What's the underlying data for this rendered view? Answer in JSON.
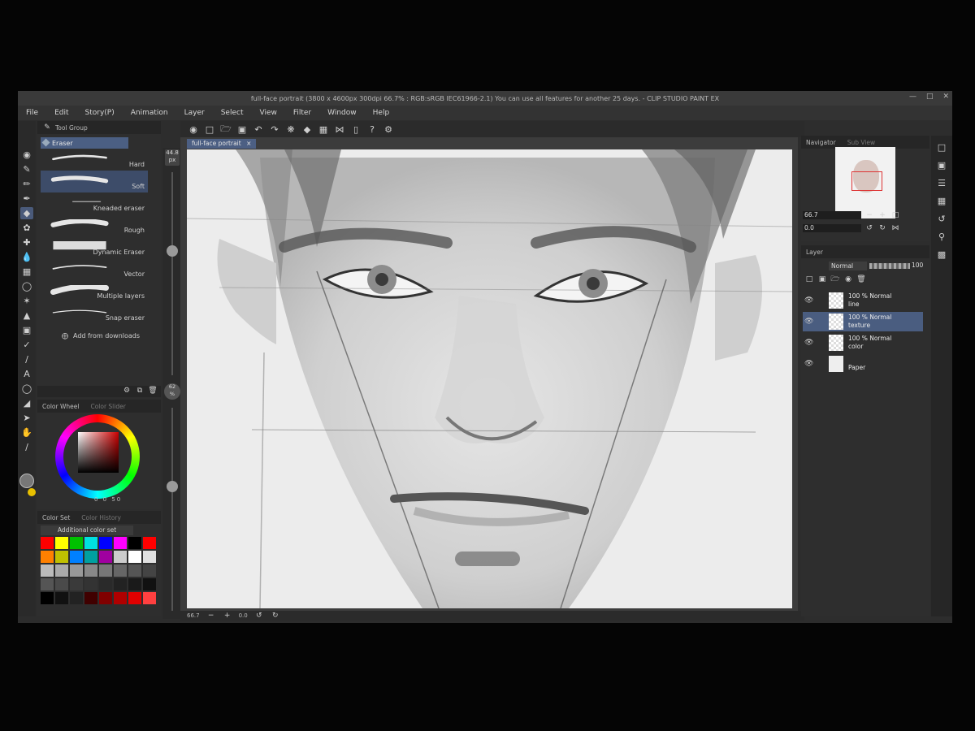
{
  "app": {
    "title": "full-face portrait (3800 x 4600px 300dpi 66.7% : RGB:sRGB IEC61966-2.1)  You can use all features for another 25 days. - CLIP STUDIO PAINT EX"
  },
  "menu": [
    "File",
    "Edit",
    "Story(P)",
    "Animation",
    "Layer",
    "Select",
    "View",
    "Filter",
    "Window",
    "Help"
  ],
  "subtool_panel": {
    "tab_label": "Tool Group",
    "group_name": "Eraser",
    "brushes": [
      {
        "label": "Hard",
        "selected": false
      },
      {
        "label": "Soft",
        "selected": true
      },
      {
        "label": "Kneaded eraser",
        "selected": false
      },
      {
        "label": "Rough",
        "selected": false
      },
      {
        "label": "Dynamic Eraser",
        "selected": false
      },
      {
        "label": "Vector",
        "selected": false
      },
      {
        "label": "Multiple layers",
        "selected": false
      },
      {
        "label": "Snap eraser",
        "selected": false
      }
    ],
    "add_label": "Add from downloads"
  },
  "brush_size": {
    "value": "44.8",
    "unit": "px"
  },
  "brush_opacity": {
    "value": "62",
    "unit": "%"
  },
  "color_wheel": {
    "tab": "Color Wheel",
    "tab2": "Color Slider",
    "readout": "0  0  50"
  },
  "color_set": {
    "tab": "Color Set",
    "tab2": "Color History",
    "set_name": "Additional color set",
    "swatches": [
      "#ff0000",
      "#ffff00",
      "#00c000",
      "#00e0e0",
      "#0000ff",
      "#ff00ff",
      "#000000",
      "#ff0000",
      "#ff8000",
      "#c0c000",
      "#0080ff",
      "#00a0a0",
      "#a000a0",
      "#cccccc",
      "#ffffff",
      "#e0e0e0",
      "#bbbbbb",
      "#aaaaaa",
      "#999999",
      "#888888",
      "#777777",
      "#666666",
      "#555555",
      "#444444",
      "#555555",
      "#4a4a4a",
      "#3a3a3a",
      "#333333",
      "#2a2a2a",
      "#222222",
      "#1a1a1a",
      "#111111",
      "#000000",
      "#111111",
      "#222222",
      "#400000",
      "#800000",
      "#b00000",
      "#e00000",
      "#ff4040"
    ]
  },
  "document_tab": "full-face portrait",
  "status": {
    "zoom": "66.7",
    "angle": "0.0"
  },
  "navigator": {
    "tab": "Navigator",
    "tab2": "Sub View",
    "zoom": "66.7",
    "rotation": "0.0"
  },
  "layer_panel": {
    "tab": "Layer",
    "blend_mode": "Normal",
    "opacity": "100",
    "layers": [
      {
        "line1": "100 % Normal",
        "line2": "line",
        "selected": false
      },
      {
        "line1": "100 % Normal",
        "line2": "texture",
        "selected": true
      },
      {
        "line1": "100 % Normal",
        "line2": "color",
        "selected": false
      },
      {
        "line1": "",
        "line2": "Paper",
        "selected": false
      }
    ]
  }
}
